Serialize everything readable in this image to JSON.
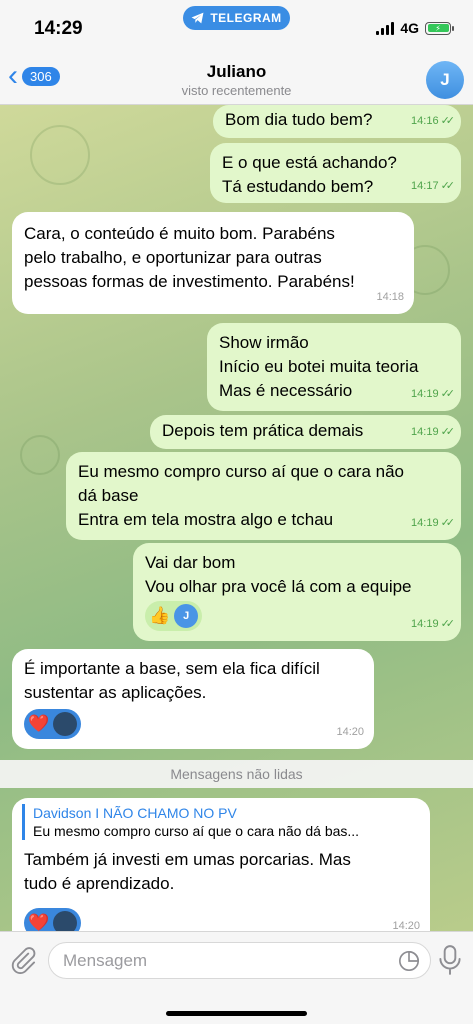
{
  "status_bar": {
    "time": "14:29",
    "app_pill": "TELEGRAM",
    "network": "4G"
  },
  "header": {
    "back_count": "306",
    "title": "Juliano",
    "subtitle": "visto recentemente",
    "avatar_letter": "J"
  },
  "messages": [
    {
      "dir": "out",
      "lines": [
        "Bom dia tudo bem?"
      ],
      "time": "14:16"
    },
    {
      "dir": "out",
      "lines": [
        "E o que está achando?",
        "Tá estudando bem?"
      ],
      "time": "14:17"
    },
    {
      "dir": "in",
      "lines": [
        "Cara, o conteúdo é muito bom. Parabéns",
        "pelo trabalho, e oportunizar para outras",
        "pessoas formas de investimento. Parabéns!"
      ],
      "time": "14:18"
    },
    {
      "dir": "out",
      "lines": [
        "Show irmão",
        "Início eu botei muita teoria",
        "Mas é necessário"
      ],
      "time": "14:19"
    },
    {
      "dir": "out",
      "lines": [
        "Depois tem prática demais"
      ],
      "time": "14:19"
    },
    {
      "dir": "out",
      "lines": [
        "Eu mesmo compro curso aí que o cara não",
        "dá base",
        "Entra em tela mostra algo e tchau"
      ],
      "time": "14:19"
    },
    {
      "dir": "out",
      "lines": [
        "Vai dar bom",
        "Vou olhar pra você lá com a equipe"
      ],
      "time": "14:19",
      "reaction": {
        "emoji": "👍",
        "avatar_letter": "J"
      }
    },
    {
      "dir": "in",
      "lines": [
        "É importante a base, sem ela fica difícil",
        "sustentar as aplicações."
      ],
      "time": "14:20",
      "reaction": {
        "emoji": "❤️"
      }
    }
  ],
  "unread_divider": "Mensagens não lidas",
  "reply_message": {
    "reply_name": "Davidson I NÃO CHAMO NO PV",
    "reply_text": "Eu mesmo compro curso aí que o cara não dá bas...",
    "lines": [
      "Também já investi em umas porcarias. Mas",
      "tudo é aprendizado."
    ],
    "time": "14:20",
    "reaction": {
      "emoji": "❤️"
    }
  },
  "input": {
    "placeholder": "Mensagem"
  },
  "colors": {
    "accent": "#2f85e8",
    "outgoing_bubble": "#e2f7cb",
    "incoming_bubble": "#ffffff",
    "read_check": "#4fa44b"
  }
}
